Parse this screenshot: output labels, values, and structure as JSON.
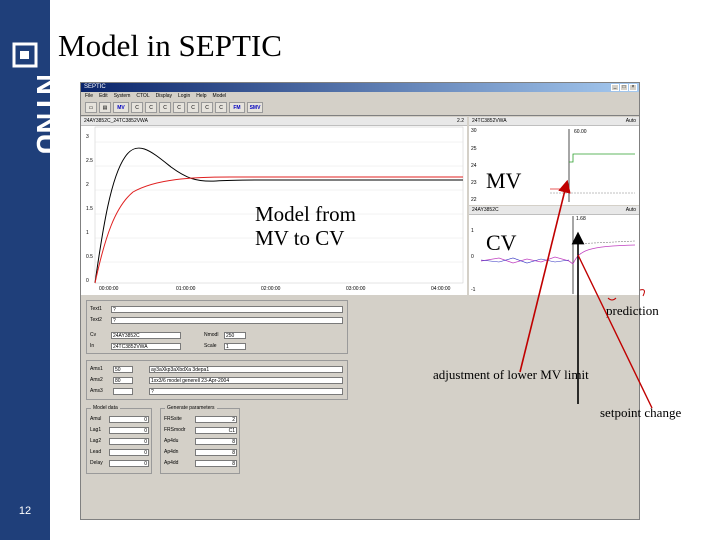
{
  "slide": {
    "title": "Model in SEPTIC",
    "number": "12",
    "logo_text": "NTNU"
  },
  "app": {
    "window_title": "SEPTIC",
    "menu": [
      "File",
      "Edit",
      "System",
      "CTOL",
      "Display",
      "Login",
      "Help",
      "Model"
    ],
    "toolbar_icons": [
      "open-icon",
      "save-icon",
      "mv-icon",
      "cv-icon",
      "cv-icon",
      "cv-icon",
      "cv-icon",
      "cv-icon",
      "cv-icon",
      "cv-icon",
      "fm-icon",
      "mv-icon"
    ],
    "main_chart": {
      "header": "24AY3852C_24TC3852VWA",
      "header_right": "2.2",
      "yticks": [
        "0",
        "0.5",
        "1",
        "1.5",
        "2",
        "2.5",
        "3"
      ],
      "xticks": [
        "00:00:00",
        "01:00:00",
        "02:00:00",
        "03:00:00",
        "04:00:00"
      ]
    },
    "mv_chart": {
      "header": "24TC3852VWA",
      "header_right": "Auto",
      "value": "60.00",
      "yticks": [
        "30",
        "25",
        "24",
        "23",
        "22"
      ]
    },
    "cv_chart": {
      "header": "24AY3852C",
      "header_right": "Auto",
      "value": "1.68",
      "yticks": [
        "1",
        "0",
        "-1"
      ]
    },
    "fields": {
      "text1_label": "Text1",
      "text1_value": "?",
      "text2_label": "Text2",
      "text2_value": "?",
      "cv_label": "Cv",
      "cv_value": "24AY3852C",
      "in_label": "In",
      "in_value": "24TC3852VWA",
      "nmodl_label": "Nmodl",
      "nmodl_value": "250",
      "scale_label": "Scale",
      "scale_value": "1",
      "ams1_label": "Ams1",
      "ams1_value": "50",
      "ams1_text": "ay3aXkp3aXbdXa 3depa1",
      "ams2_label": "Ams2",
      "ams2_value": "80",
      "ams2_text": "1xx3/6 model generell 23-Apr-2004",
      "ams3_label": "Ams3",
      "ams3_value": "",
      "ams3_text": "?"
    },
    "model_data": {
      "title": "Model data",
      "rows": [
        {
          "label": "Amul",
          "value": "0"
        },
        {
          "label": "Lag1",
          "value": "0"
        },
        {
          "label": "Lag2",
          "value": "0"
        },
        {
          "label": "Lead",
          "value": "0"
        },
        {
          "label": "Delay",
          "value": "0"
        }
      ]
    },
    "gen_params": {
      "title": "Generate parameters",
      "rows": [
        {
          "label": "FRSsite",
          "value": "2"
        },
        {
          "label": "FRSmodr",
          "value": "C1"
        },
        {
          "label": "Ap4du",
          "value": "8"
        },
        {
          "label": "Ap4dn",
          "value": "8"
        },
        {
          "label": "Ap4dd",
          "value": "8"
        }
      ]
    }
  },
  "annotations": {
    "mv_label": "MV",
    "cv_label": "CV",
    "model_from": "Model from",
    "mv_to_cv": "MV to CV",
    "prediction": "prediction",
    "adjustment": "adjustment of lower MV limit",
    "setpoint": "setpoint change"
  },
  "colors": {
    "sidebar": "#1f3f7a",
    "arrow": "#c00000",
    "main_red": "#e02020",
    "main_black": "#000000",
    "mv_green": "#2ca02c",
    "cv_magenta": "#c040c0",
    "cv_blue": "#3030c0"
  }
}
